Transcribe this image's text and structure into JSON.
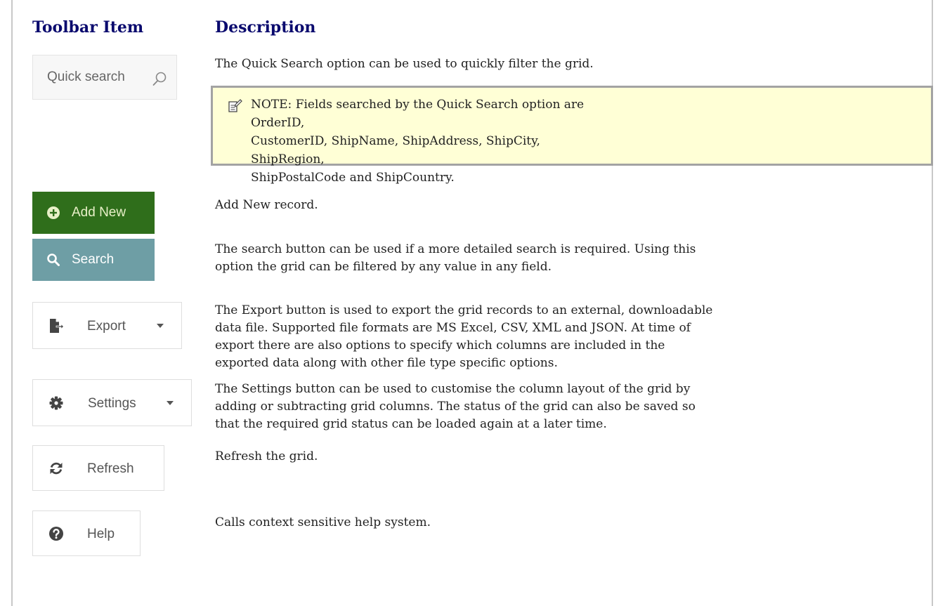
{
  "headers": {
    "toolbar_item": "Toolbar Item",
    "description": "Description"
  },
  "quick_search": {
    "placeholder": "Quick search",
    "icon": "search-icon",
    "description": "The Quick Search option can be used to quickly filter the grid."
  },
  "note": {
    "icon": "note-icon",
    "line1": "NOTE: Fields searched by the Quick Search option are OrderID,",
    "line2": "CustomerID, ShipName, ShipAddress, ShipCity, ShipRegion,",
    "line3": "ShipPostalCode and ShipCountry.",
    "bg_color": "#ffffd6"
  },
  "add_new": {
    "label": "Add New",
    "icon": "plus-circle-icon",
    "color": "#2f6e1b",
    "description": "Add New record."
  },
  "search": {
    "label": "Search",
    "icon": "search-icon",
    "color": "#6e9ea5",
    "description_line1": "The search button can be used if a more detailed search is required.  Using this",
    "description_line2": "option the grid can be filtered by any value in any field."
  },
  "export": {
    "label": "Export",
    "icon": "file-export-icon",
    "description_line1": "The Export button is used to export the grid records to an external, downloadable",
    "description_line2": "data file.  Supported file formats are MS Excel, CSV, XML and JSON.  At time of",
    "description_line3": "export there are also options to specify which columns are included in the",
    "description_line4": "exported data along with other file type specific options."
  },
  "settings": {
    "label": "Settings",
    "icon": "gear-icon",
    "description_line1": "The Settings button can be used to customise the column layout of the grid by",
    "description_line2": "adding or subtracting grid columns.  The status of the grid can also be saved so",
    "description_line3": "that the required grid status can be loaded again at a later time."
  },
  "refresh": {
    "label": "Refresh",
    "icon": "refresh-icon",
    "description": "Refresh the grid."
  },
  "help": {
    "label": "Help",
    "icon": "question-circle-icon",
    "description": "Calls context sensitive help system."
  }
}
